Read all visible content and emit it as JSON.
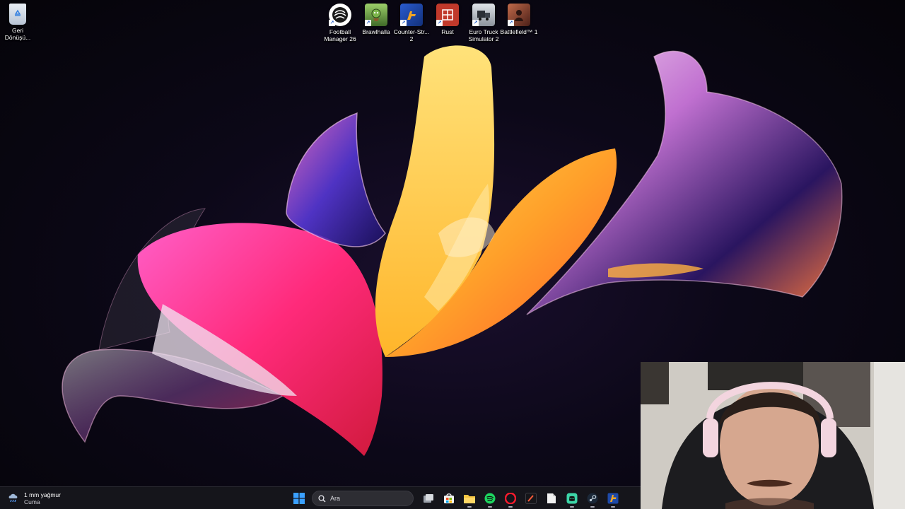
{
  "desktop": {
    "recycle_bin": {
      "label": "Geri\nDönüşü...",
      "icon": "recycle-bin-icon"
    },
    "shortcuts": [
      {
        "label": "Football\nManager 26",
        "icon": "football-manager-icon",
        "color": "#e8e8e8"
      },
      {
        "label": "Brawlhalla",
        "icon": "brawlhalla-icon",
        "color": "#5a8a3a"
      },
      {
        "label": "Counter-Str...\n2",
        "icon": "counter-strike-icon",
        "color": "#1f4aa8"
      },
      {
        "label": "Rust",
        "icon": "rust-icon",
        "color": "#c0392b"
      },
      {
        "label": "Euro Truck\nSimulator 2",
        "icon": "euro-truck-icon",
        "color": "#bfc4cc"
      },
      {
        "label": "Battlefield™ 1",
        "icon": "battlefield-icon",
        "color": "#7a3a2a"
      }
    ]
  },
  "taskbar": {
    "weather": {
      "temperature": "1 mm yağmur",
      "day": "Cuma",
      "icon": "rain-cloud-icon"
    },
    "start_icon": "windows-start-icon",
    "search": {
      "placeholder": "Ara",
      "icon": "search-icon"
    },
    "apps": [
      {
        "name": "task-view",
        "icon": "task-view-icon"
      },
      {
        "name": "microsoft-store",
        "icon": "store-icon"
      },
      {
        "name": "file-explorer",
        "icon": "folder-icon"
      },
      {
        "name": "spotify",
        "icon": "spotify-icon"
      },
      {
        "name": "opera",
        "icon": "opera-icon"
      },
      {
        "name": "app-dark",
        "icon": "app-icon"
      },
      {
        "name": "notepad",
        "icon": "document-icon"
      },
      {
        "name": "discord",
        "icon": "discord-icon"
      },
      {
        "name": "steam",
        "icon": "steam-icon"
      },
      {
        "name": "counter-strike",
        "icon": "counter-strike-icon"
      }
    ]
  },
  "webcam": {
    "content": "streamer-webcam"
  }
}
